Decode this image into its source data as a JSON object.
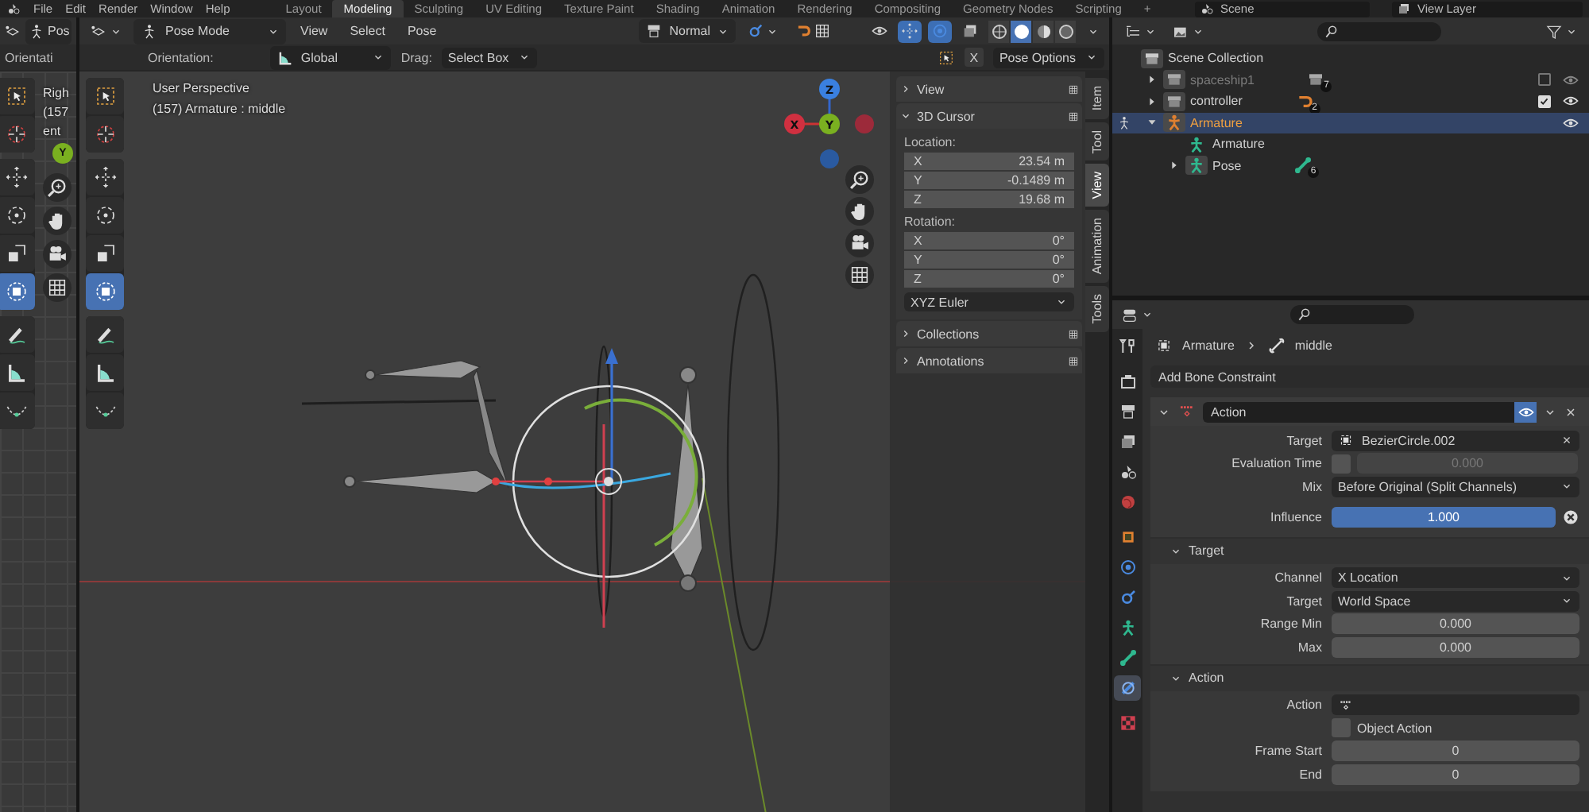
{
  "topbar": {
    "menus": [
      "File",
      "Edit",
      "Render",
      "Window",
      "Help"
    ],
    "workspaces": [
      {
        "label": "Layout",
        "selected": false
      },
      {
        "label": "Modeling",
        "selected": true
      },
      {
        "label": "Sculpting",
        "selected": false
      },
      {
        "label": "UV Editing",
        "selected": false
      },
      {
        "label": "Texture Paint",
        "selected": false
      },
      {
        "label": "Shading",
        "selected": false
      },
      {
        "label": "Animation",
        "selected": false
      },
      {
        "label": "Rendering",
        "selected": false
      },
      {
        "label": "Compositing",
        "selected": false
      },
      {
        "label": "Geometry Nodes",
        "selected": false
      },
      {
        "label": "Scripting",
        "selected": false
      }
    ],
    "add": "+",
    "scene": "Scene",
    "view_layer": "View Layer"
  },
  "left_viewport": {
    "mode": "Pos",
    "orientation": "Orientati",
    "overlay": [
      "Righ",
      "(157",
      "ent"
    ],
    "gizmo_axis": "Y",
    "tool_groups": [
      [
        {
          "kind": "select",
          "selected": false
        },
        {
          "kind": "cursor",
          "selected": false
        }
      ],
      [
        {
          "kind": "move",
          "selected": false
        },
        {
          "kind": "rotate",
          "selected": false
        },
        {
          "kind": "scale",
          "selected": false
        },
        {
          "kind": "transform",
          "selected": true
        }
      ],
      [
        {
          "kind": "annotate",
          "selected": false
        },
        {
          "kind": "measure",
          "selected": false
        },
        {
          "kind": "curve",
          "selected": false
        }
      ]
    ]
  },
  "viewport": {
    "mode": "Pose Mode",
    "menus": [
      "View",
      "Select",
      "Pose"
    ],
    "pivot": "Normal",
    "header_toggles": [
      {
        "kind": "visibility",
        "on": false
      },
      {
        "kind": "gizmo",
        "on": true
      },
      {
        "kind": "overlay",
        "on": true
      },
      {
        "kind": "xray",
        "on": false
      }
    ],
    "shading": [
      {
        "kind": "wireframe",
        "selected": false
      },
      {
        "kind": "solid",
        "selected": true
      },
      {
        "kind": "material",
        "selected": false
      },
      {
        "kind": "rendered",
        "selected": false
      }
    ],
    "orientation_label": "Orientation:",
    "orientation": "Global",
    "drag_label": "Drag:",
    "drag": "Select Box",
    "mirror": "X",
    "pose_options": "Pose Options",
    "overlay": [
      "User Perspective",
      "(157) Armature : middle"
    ],
    "gizmo_axes": [
      "Z",
      "X",
      "Y"
    ],
    "tool_groups": [
      [
        {
          "kind": "select",
          "selected": false
        },
        {
          "kind": "cursor",
          "selected": false
        }
      ],
      [
        {
          "kind": "move",
          "selected": false
        },
        {
          "kind": "rotate",
          "selected": false
        },
        {
          "kind": "scale",
          "selected": false
        },
        {
          "kind": "transform",
          "selected": true
        }
      ],
      [
        {
          "kind": "annotate",
          "selected": false
        },
        {
          "kind": "measure",
          "selected": false
        },
        {
          "kind": "curve",
          "selected": false
        }
      ]
    ]
  },
  "sidebar": {
    "panels": [
      {
        "title": "View",
        "expanded": false
      },
      {
        "title": "3D Cursor",
        "expanded": true,
        "sections": [
          {
            "label": "Location:",
            "fields": [
              {
                "axis": "X",
                "value": "23.54 m"
              },
              {
                "axis": "Y",
                "value": "-0.1489 m"
              },
              {
                "axis": "Z",
                "value": "19.68 m"
              }
            ]
          },
          {
            "label": "Rotation:",
            "fields": [
              {
                "axis": "X",
                "value": "0°"
              },
              {
                "axis": "Y",
                "value": "0°"
              },
              {
                "axis": "Z",
                "value": "0°"
              }
            ]
          }
        ],
        "rotation_mode": "XYZ Euler"
      },
      {
        "title": "Collections",
        "expanded": false
      },
      {
        "title": "Annotations",
        "expanded": false
      }
    ],
    "tabs": [
      {
        "label": "Item",
        "selected": false
      },
      {
        "label": "Tool",
        "selected": false
      },
      {
        "label": "View",
        "selected": true
      },
      {
        "label": "Animation",
        "selected": false
      },
      {
        "label": "Tools",
        "selected": false
      }
    ]
  },
  "outliner": {
    "tree": [
      {
        "label": "Scene Collection",
        "kind": "scene_collection",
        "selected": false,
        "children": [
          {
            "label": "spaceship1",
            "kind": "collection",
            "selected": false,
            "expanded": false,
            "disabled": true,
            "checked": false,
            "badge": "7"
          },
          {
            "label": "controller",
            "kind": "collection",
            "selected": false,
            "expanded": false,
            "disabled": false,
            "checked": true,
            "badge": "2"
          },
          {
            "label": "Armature",
            "kind": "armature_object",
            "selected": true,
            "expanded": true,
            "children": [
              {
                "label": "Armature",
                "kind": "armature_data",
                "selected": false
              },
              {
                "label": "Pose",
                "kind": "pose",
                "selected": false,
                "expanded": false,
                "badge": "6"
              }
            ]
          }
        ]
      }
    ]
  },
  "properties": {
    "tabs": [
      {
        "kind": "tool",
        "selected": false
      },
      {
        "kind": "render",
        "selected": false
      },
      {
        "kind": "output",
        "selected": false
      },
      {
        "kind": "view_layer",
        "selected": false
      },
      {
        "kind": "scene",
        "selected": false
      },
      {
        "kind": "world",
        "selected": false
      },
      {
        "kind": "object",
        "selected": false
      },
      {
        "kind": "physics",
        "selected": false
      },
      {
        "kind": "constraints",
        "selected": false
      },
      {
        "kind": "data",
        "selected": false
      },
      {
        "kind": "bone",
        "selected": false
      },
      {
        "kind": "bone_constraint",
        "selected": true
      },
      {
        "kind": "texture",
        "selected": false
      }
    ],
    "breadcrumb": [
      "Armature",
      "middle"
    ],
    "add_button": "Add Bone Constraint",
    "constraint": {
      "name": "Action",
      "expanded": true,
      "enabled": true,
      "rows": [
        {
          "kind": "object",
          "label": "Target",
          "value": "BezierCircle.002"
        },
        {
          "kind": "toggle_number",
          "label": "Evaluation Time",
          "checked": false,
          "value": "0.000"
        },
        {
          "kind": "dropdown",
          "label": "Mix",
          "value": "Before Original (Split Channels)"
        },
        {
          "kind": "slider",
          "label": "Influence",
          "value": "1.000",
          "level": 1
        }
      ],
      "subpanels": [
        {
          "title": "Target",
          "expanded": true,
          "rows": [
            {
              "kind": "dropdown",
              "label": "Channel",
              "value": "X Location"
            },
            {
              "kind": "dropdown",
              "label": "Target",
              "value": "World Space"
            },
            {
              "kind": "number",
              "label": "Range Min",
              "value": "0.000"
            },
            {
              "kind": "number",
              "label": "Max",
              "value": "0.000"
            }
          ]
        },
        {
          "title": "Action",
          "expanded": true,
          "rows": [
            {
              "kind": "action",
              "label": "Action"
            },
            {
              "kind": "checkbox",
              "label": "Object Action",
              "checked": false
            },
            {
              "kind": "number",
              "label": "Frame Start",
              "value": "0"
            },
            {
              "kind": "number",
              "label": "End",
              "value": "0"
            }
          ]
        }
      ]
    }
  }
}
